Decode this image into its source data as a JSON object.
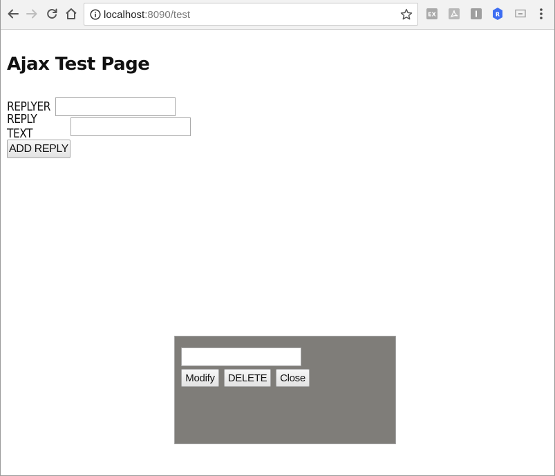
{
  "browser": {
    "url_host": "localhost",
    "url_path": ":8090/test",
    "extensions": [
      {
        "name": "ex",
        "label": "EX",
        "color": "#a9a9a9"
      },
      {
        "name": "pdf",
        "label": "",
        "color": "#b5b5b5"
      },
      {
        "name": "i",
        "label": "I",
        "color": "#9e9e9e"
      },
      {
        "name": "r",
        "label": "R",
        "color": "#3d6df2"
      }
    ]
  },
  "page": {
    "title": "Ajax Test Page",
    "replyer_label": "REPLYER",
    "reply_text_label": "REPLY TEXT",
    "replyer_value": "",
    "reply_text_value": "",
    "add_reply_label": "ADD REPLY"
  },
  "modal": {
    "input_value": "",
    "modify_label": "Modify",
    "delete_label": "DELETE",
    "close_label": "Close",
    "background_color": "#7f7d79"
  }
}
